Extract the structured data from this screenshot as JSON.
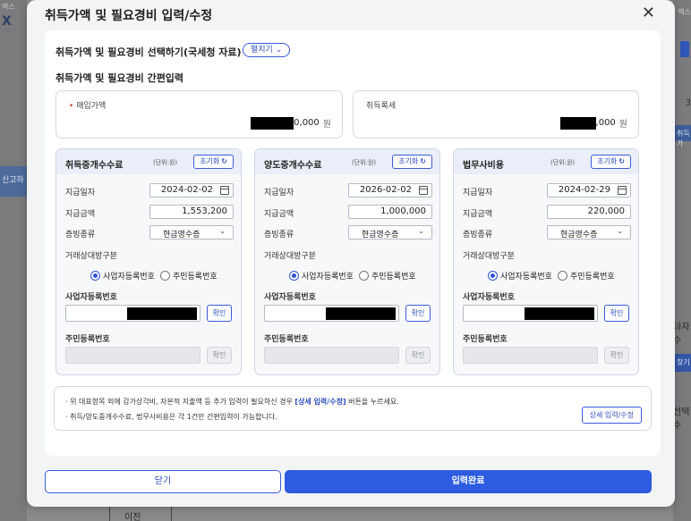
{
  "background": {
    "left_top_text": "렉스",
    "left_logo": "X",
    "left_tab": "신고하",
    "right_top_text": "렉스",
    "right_3": "3",
    "right_tab1": "취득가",
    "right_label1": "타자수",
    "right_tab2": "찾기",
    "right_label2": "선택수",
    "bottom_prev": "이전"
  },
  "modal": {
    "title": "취득가액 및 필요경비 입력/수정",
    "close_symbol": "✕"
  },
  "select_section": {
    "title": "취득가액 및 필요경비 선택하기(국세청 자료)",
    "expand_label": "펼치기 ⌄"
  },
  "quick_section": {
    "title": "취득가액 및 필요경비 간편입력"
  },
  "purchase": {
    "required_mark": "•",
    "label": "매입가액",
    "value_suffix": "0,000",
    "unit": "원"
  },
  "acq_tax": {
    "label": "취득록세",
    "value_suffix": ",000",
    "unit": "원"
  },
  "cards": [
    {
      "title": "취득중개수수료",
      "unit_note": "(단위:원)",
      "reset_label": "초기화",
      "pay_date_label": "지급일자",
      "pay_date": "2024-02-02",
      "pay_amount_label": "지급금액",
      "pay_amount": "1,553,200",
      "proof_label": "증빙종류",
      "proof_value": "현금영수증",
      "party_label": "거래상대방구분",
      "radio_biz": "사업자등록번호",
      "radio_res": "주민등록번호",
      "biz_no_label": "사업자등록번호",
      "confirm_label": "확인",
      "res_no_label": "주민등록번호"
    },
    {
      "title": "양도중개수수료",
      "unit_note": "(단위:원)",
      "reset_label": "초기화",
      "pay_date_label": "지급일자",
      "pay_date": "2026-02-02",
      "pay_amount_label": "지급금액",
      "pay_amount": "1,000,000",
      "proof_label": "증빙종류",
      "proof_value": "현금영수증",
      "party_label": "거래상대방구분",
      "radio_biz": "사업자등록번호",
      "radio_res": "주민등록번호",
      "biz_no_label": "사업자등록번호",
      "confirm_label": "확인",
      "res_no_label": "주민등록번호"
    },
    {
      "title": "법무사비용",
      "unit_note": "(단위:원)",
      "reset_label": "초기화",
      "pay_date_label": "지급일자",
      "pay_date": "2024-02-29",
      "pay_amount_label": "지급금액",
      "pay_amount": "220,000",
      "proof_label": "증빙종류",
      "proof_value": "현금영수증",
      "party_label": "거래상대방구분",
      "radio_biz": "사업자등록번호",
      "radio_res": "주민등록번호",
      "biz_no_label": "사업자등록번호",
      "confirm_label": "확인",
      "res_no_label": "주민등록번호"
    }
  ],
  "notice": {
    "line1_pre": "· 위 대표항목 외에 감가상각비, 자본적 지출액 등 추가 입력이 필요하신 경우 ",
    "line1_link": "[상세 입력/수정]",
    "line1_post": " 버튼을 누르세요.",
    "line2": "· 취득/양도중개수수료, 법무사비용은 각 1건만 간편입력이 가능합니다.",
    "detail_button": "상세 입력/수정"
  },
  "footer": {
    "close_label": "닫기",
    "done_label": "입력완료"
  },
  "colors": {
    "accent": "#2d5ce0",
    "required": "#e03131"
  }
}
